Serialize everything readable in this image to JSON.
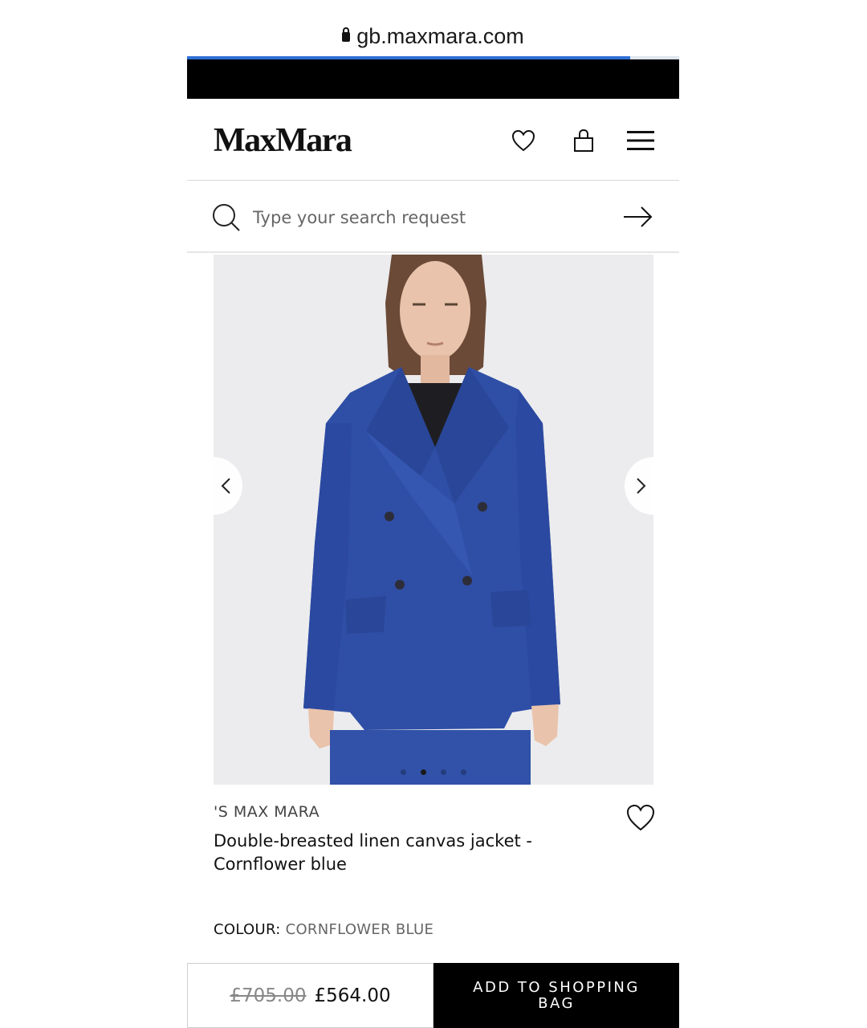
{
  "browser": {
    "url": "gb.maxmara.com",
    "load_progress": 0.9
  },
  "header": {
    "logo": "MaxMara",
    "icons": [
      "heart-icon",
      "shopping-bag-icon",
      "hamburger-menu-icon"
    ]
  },
  "search": {
    "placeholder": "Type your search request",
    "value": ""
  },
  "gallery": {
    "image_count": 4,
    "active_index": 1,
    "colors": {
      "background": "#ececee",
      "jacket": "#2f4fa6"
    }
  },
  "product": {
    "brand": "'S MAX MARA",
    "title": "Double-breasted linen canvas jacket - Cornflower blue",
    "colour_label": "COLOUR:",
    "colour_value": "CORNFLOWER BLUE"
  },
  "buy": {
    "old_price": "£705.00",
    "price": "£564.00",
    "add_label": "ADD TO SHOPPING BAG"
  }
}
